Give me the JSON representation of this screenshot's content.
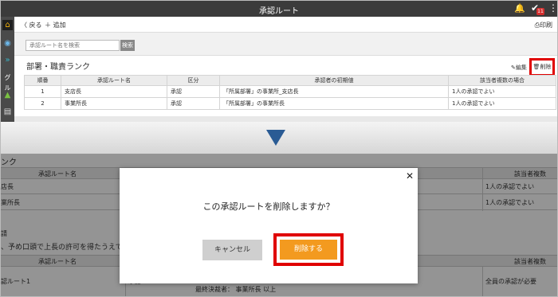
{
  "top": {
    "title": "承認ルート",
    "badge_count": "11",
    "toolbar": {
      "back": "〈 戻る",
      "add": "＋ 追加",
      "print": "印刷"
    },
    "search": {
      "placeholder": "承認ルート名を検索",
      "button": "検索"
    },
    "section_title": "部署・職責ランク",
    "edit": "編集",
    "delete": "削除",
    "leftnav_label": "グル",
    "table": {
      "headers": [
        "順番",
        "承認ルート名",
        "区分",
        "承認者の初期値",
        "該当者複数の場合"
      ],
      "rows": [
        [
          "1",
          "支店長",
          "承認",
          "「所属部署」の事業所_支店長",
          "1人の承認でよい"
        ],
        [
          "2",
          "事業所長",
          "承認",
          "「所属部署」の事業所長",
          "1人の承認でよい"
        ]
      ]
    }
  },
  "lower": {
    "rank_fragment": "ンク",
    "header_col1": "承認ルート名",
    "header_col_right": "該当者複数",
    "rows": [
      {
        "name": "店長",
        "right": "1人の承認でよい"
      },
      {
        "name": "業所長",
        "right": "1人の承認でよい"
      }
    ],
    "note_title": "請",
    "note_text": "、予め口頭で上長の許可を得たうえで",
    "header2_col1": "承認ルート名",
    "header2_col_right": "該当者複数",
    "row3": {
      "name": "認ルート1",
      "mid": "承認",
      "approver": "最終決裁者：  事業所長 以上",
      "right": "全員の承認が必要"
    }
  },
  "dialog": {
    "message": "この承認ルートを削除しますか？",
    "cancel": "キャンセル",
    "confirm": "削除する"
  },
  "colors": {
    "highlight": "#e00000",
    "confirm": "#f39a1f",
    "arrow": "#2a5b94",
    "topbar": "#3b3b3b"
  }
}
